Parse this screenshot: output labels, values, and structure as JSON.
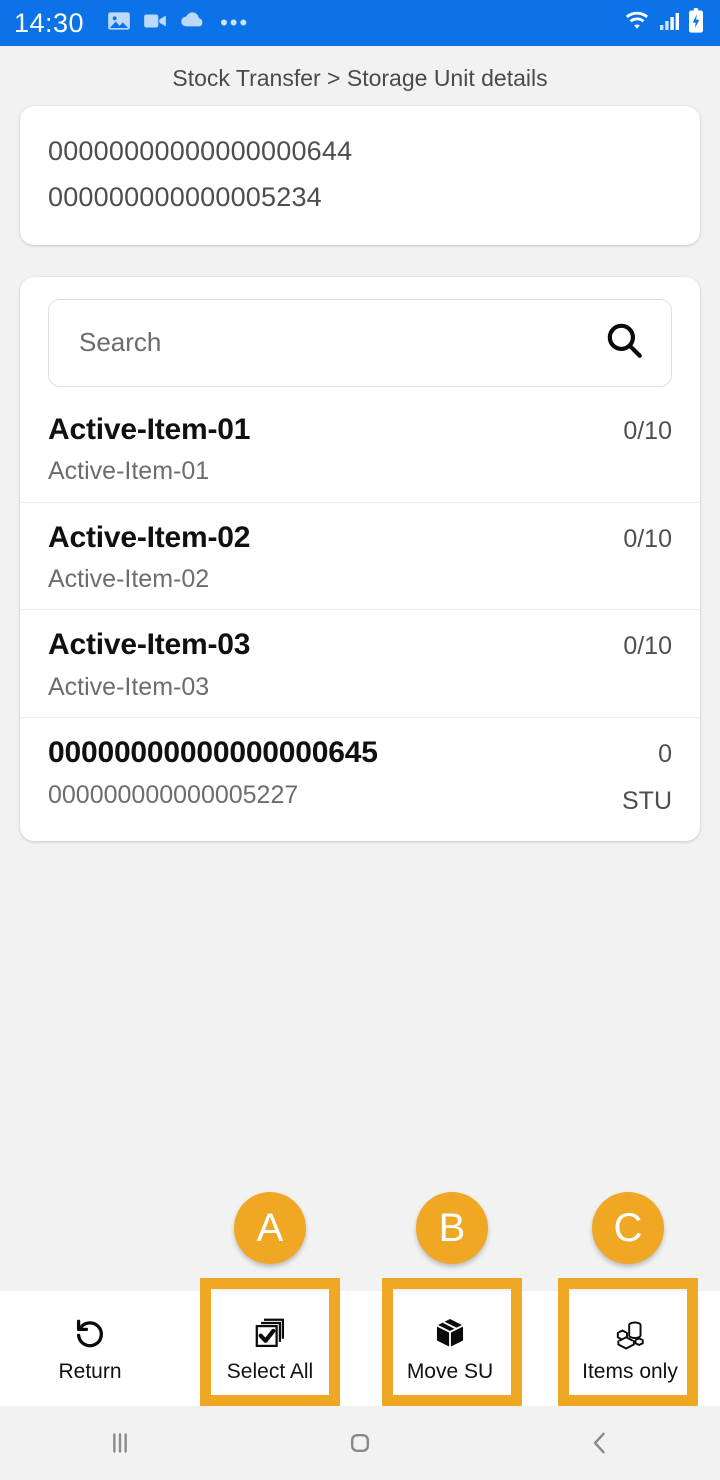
{
  "status_bar": {
    "time": "14:30",
    "left_icons": [
      "image-icon",
      "video-camera-icon",
      "cloud-icon",
      "more-dots-icon"
    ],
    "right_icons": [
      "wifi-icon",
      "cellular-signal-icon",
      "battery-charging-icon"
    ],
    "background_color": "#0B72E7",
    "overflow_label": "•••"
  },
  "breadcrumb": {
    "text": "Stock Transfer > Storage Unit details"
  },
  "storage_unit_card": {
    "line1": "00000000000000000644",
    "line2": "000000000000005234"
  },
  "search": {
    "value": "",
    "placeholder": "Search",
    "icon": "search-icon"
  },
  "list": {
    "rows": [
      {
        "title": "Active-Item-01",
        "subtitle": "Active-Item-01",
        "qty": "0/10",
        "unit": ""
      },
      {
        "title": "Active-Item-02",
        "subtitle": "Active-Item-02",
        "qty": "0/10",
        "unit": ""
      },
      {
        "title": "Active-Item-03",
        "subtitle": "Active-Item-03",
        "qty": "0/10",
        "unit": ""
      },
      {
        "title": "00000000000000000645",
        "subtitle": "000000000000005227",
        "qty": "0",
        "unit": "STU"
      }
    ]
  },
  "toolbar": {
    "items": [
      {
        "label": "Return",
        "icon": "undo-rotate-icon"
      },
      {
        "label": "Select All",
        "icon": "select-all-checkbox-stack-icon"
      },
      {
        "label": "Move SU",
        "icon": "package-box-icon"
      },
      {
        "label": "Items only",
        "icon": "loose-items-icon"
      }
    ]
  },
  "annotations": {
    "accent_color": "#EFA724",
    "markers": [
      {
        "letter": "A",
        "target": "Select All"
      },
      {
        "letter": "B",
        "target": "Move SU"
      },
      {
        "letter": "C",
        "target": "Items only"
      }
    ]
  },
  "nav_bar": {
    "buttons": [
      {
        "icon": "recents-icon",
        "glyph": "|||"
      },
      {
        "icon": "home-icon",
        "glyph": ""
      },
      {
        "icon": "back-icon",
        "glyph": "‹"
      }
    ]
  }
}
